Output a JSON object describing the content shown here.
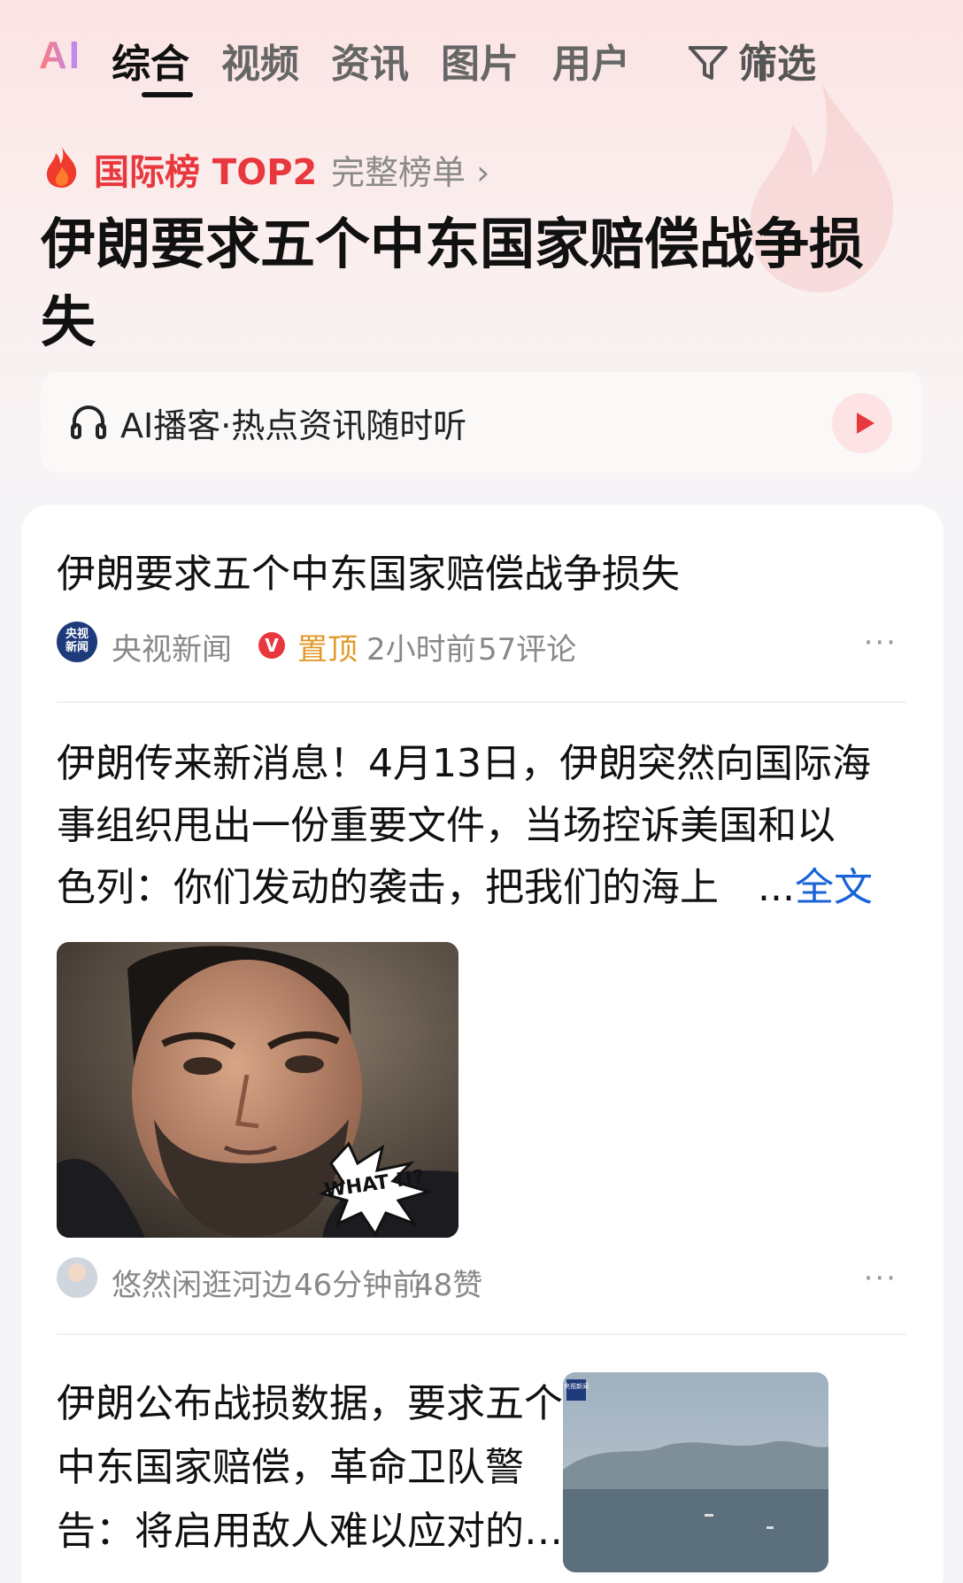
{
  "tabs": {
    "ai_logo": "AI",
    "items": [
      "综合",
      "视频",
      "资讯",
      "图片",
      "用户"
    ],
    "filter_label": "筛选"
  },
  "hot_rank": {
    "label": "国际榜 TOP2",
    "link": "完整榜单 ›",
    "headline_line1": "伊朗要求五个中东国家赔偿战争损",
    "headline_line2": "失"
  },
  "podcast": {
    "label": "AI播客·热点资讯随时听"
  },
  "post1": {
    "title": "伊朗要求五个中东国家赔偿战争损失",
    "avatar_text": "央视新闻",
    "source": "央视新闻",
    "verified": "V",
    "pinned": "置顶",
    "time": "2小时前",
    "comments": "57评论",
    "more": "···"
  },
  "post2": {
    "line1": "伊朗传来新消息！4月13日，伊朗突然向国际海",
    "line2": "事组织甩出一份重要文件，当场控诉美国和以",
    "line3": "色列：你们发动的袭击，把我们的海上　...",
    "read_more": "全文",
    "image_caption": "WHAT !!?",
    "author": "悠然闲逛河边",
    "time": "46分钟前",
    "likes": "48赞",
    "more": "···"
  },
  "post3": {
    "line1": "伊朗公布战损数据，要求五个",
    "line2": "中东国家赔偿，革命卫队警",
    "line3": "告：将启用敌人难以应对的…",
    "thumb_logo": "央视新闻"
  },
  "colors": {
    "accent_red": "#e8383d",
    "link_blue": "#1a63d6",
    "pin_orange": "#e09a2a"
  }
}
